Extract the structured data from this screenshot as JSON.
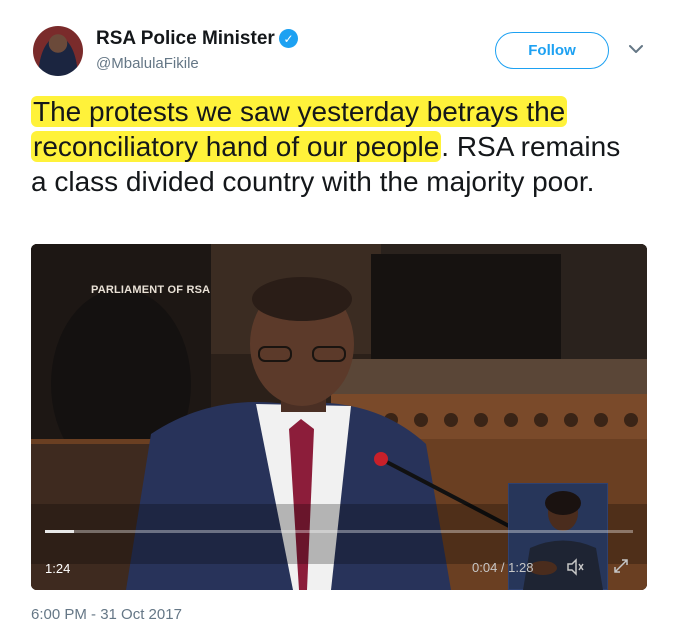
{
  "author": {
    "name": "RSA Police Minister",
    "handle": "@MbalulaFikile",
    "verified_icon": "verified-badge-icon"
  },
  "follow_label": "Follow",
  "tweet": {
    "text_highlighted": "The protests we saw yesterday betrays the reconciliatory hand of our people",
    "text_rest": ". RSA remains a class divided country with the majority poor.",
    "highlight_color": "#fff23a"
  },
  "video": {
    "watermark": "PARLIAMENT OF RSA",
    "duration": "1:24",
    "time_readout": "0:04 / 1:28",
    "progress": 0.05
  },
  "timestamp": "6:00 PM - 31 Oct 2017",
  "colors": {
    "accent": "#1da1f2",
    "secondary_text": "#657786",
    "primary_text": "#14171a"
  }
}
